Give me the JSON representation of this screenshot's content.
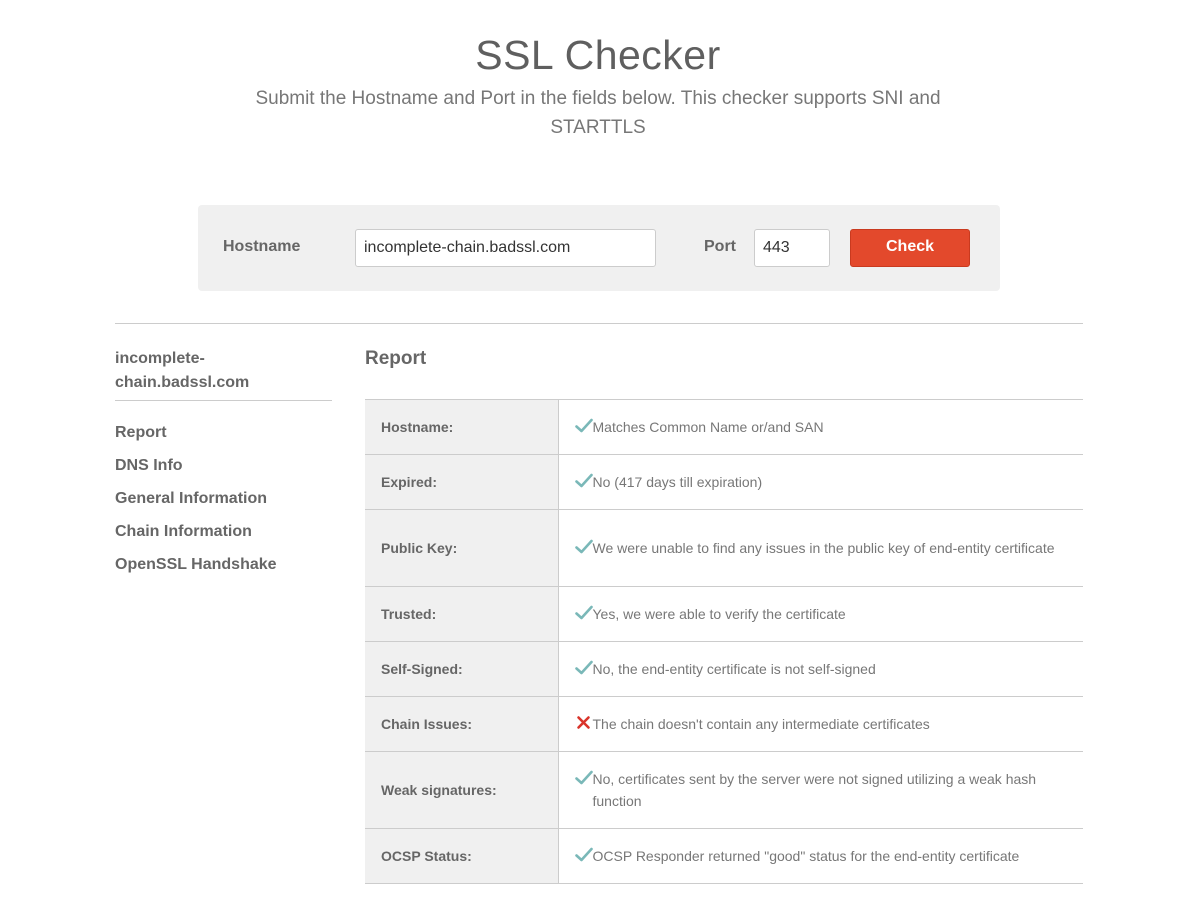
{
  "header": {
    "title": "SSL Checker",
    "subtitle": "Submit the Hostname and Port in the fields below. This checker supports SNI and STARTTLS"
  },
  "form": {
    "hostname_label": "Hostname",
    "hostname_value": "incomplete-chain.badssl.com",
    "port_label": "Port",
    "port_value": "443",
    "check_label": "Check"
  },
  "sidebar": {
    "host": "incomplete-chain.badssl.com",
    "items": [
      {
        "label": "Report"
      },
      {
        "label": "DNS Info"
      },
      {
        "label": "General Information"
      },
      {
        "label": "Chain Information"
      },
      {
        "label": "OpenSSL Handshake"
      }
    ]
  },
  "report": {
    "title": "Report",
    "rows": [
      {
        "key": "Hostname:",
        "status": "ok",
        "value": "Matches Common Name or/and SAN"
      },
      {
        "key": "Expired:",
        "status": "ok",
        "value": "No (417 days till expiration)"
      },
      {
        "key": "Public Key:",
        "status": "ok",
        "value": "We were unable to find any issues in the public key of end-entity certificate"
      },
      {
        "key": "Trusted:",
        "status": "ok",
        "value": "Yes, we were able to verify the certificate"
      },
      {
        "key": "Self-Signed:",
        "status": "ok",
        "value": "No, the end-entity certificate is not self-signed"
      },
      {
        "key": "Chain Issues:",
        "status": "error",
        "value": "The chain doesn't contain any intermediate certificates"
      },
      {
        "key": "Weak signatures:",
        "status": "ok",
        "value": "No, certificates sent by the server were not signed utilizing a weak hash function"
      },
      {
        "key": "OCSP Status:",
        "status": "ok",
        "value": "OCSP Responder returned \"good\" status for the end-entity certificate"
      }
    ]
  },
  "icons": {
    "ok": "check-icon",
    "error": "cross-icon"
  },
  "colors": {
    "ok": "#7ab8b8",
    "error": "#d9342b",
    "button": "#e3492c"
  }
}
